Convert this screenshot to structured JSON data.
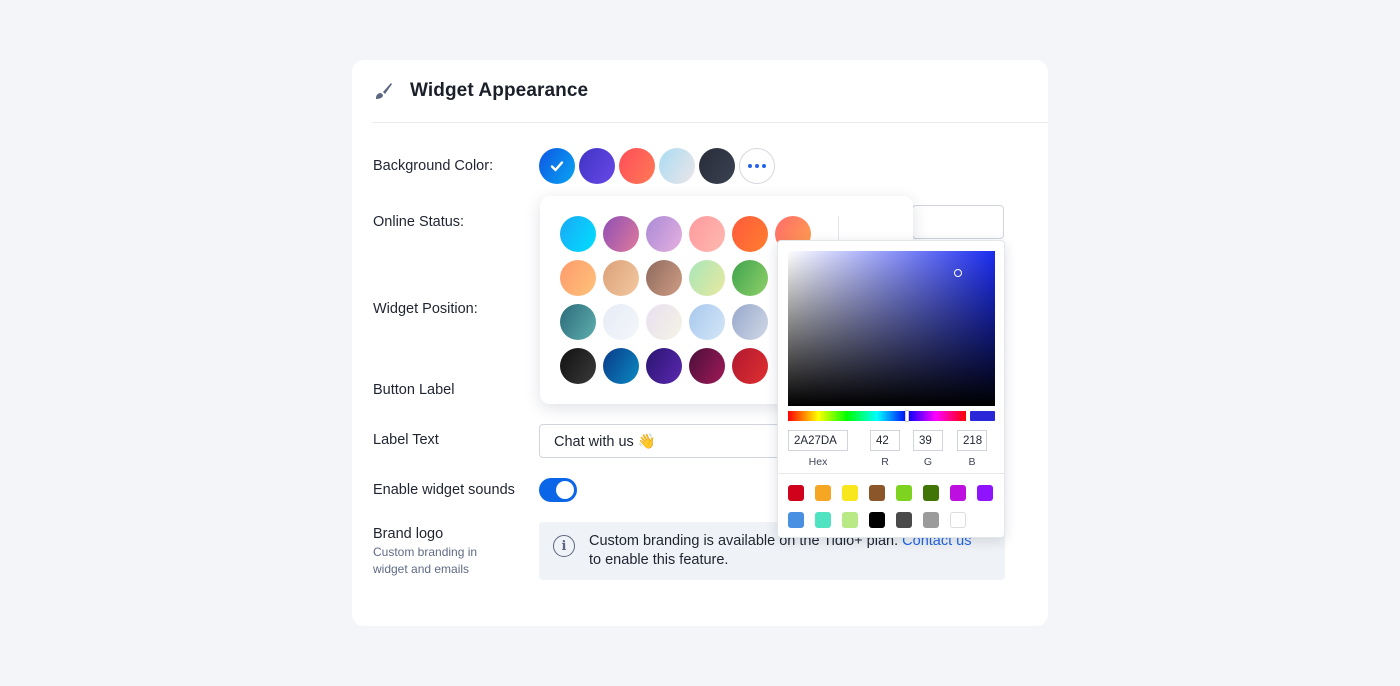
{
  "header": {
    "title": "Widget Appearance",
    "icon": "paintbrush-icon"
  },
  "labels": {
    "background_color": "Background Color:",
    "online_status": "Online Status:",
    "widget_position": "Widget Position:",
    "button_label": "Button Label",
    "label_text": "Label Text",
    "enable_sounds": "Enable widget sounds",
    "brand_logo": "Brand logo",
    "brand_logo_sub": "Custom branding in widget and emails"
  },
  "background_swatches": [
    {
      "name": "blue",
      "gradient": [
        "#0c56e3",
        "#0aa6f2"
      ],
      "selected": true
    },
    {
      "name": "purple",
      "gradient": [
        "#3e34c4",
        "#6a48e6"
      ],
      "selected": false
    },
    {
      "name": "coral",
      "gradient": [
        "#ff4d5a",
        "#ff7a55"
      ],
      "selected": false
    },
    {
      "name": "light-blue",
      "gradient": [
        "#a9dcf3",
        "#ece5e8"
      ],
      "selected": false
    },
    {
      "name": "dark",
      "gradient": [
        "#272c38",
        "#3b4252"
      ],
      "selected": false
    }
  ],
  "more_colors_icon": "more-dots-icon",
  "label_text_value": "Chat with us 👋",
  "sounds_enabled": true,
  "info": {
    "text": "Custom branding is available on the Tidio+ plan.",
    "link": "Contact us",
    "text_after": "to enable this feature."
  },
  "gradient_palette": [
    [
      "#1aa8f5",
      "#00e0ff"
    ],
    [
      "#8e4fb5",
      "#e07a9c"
    ],
    [
      "#a98ad6",
      "#e6b0e0"
    ],
    [
      "#ff9a9e",
      "#fdb9b0"
    ],
    [
      "#ff5a3c",
      "#ff7e2e"
    ],
    [
      "#ff6b6b",
      "#ffa14d"
    ],
    [
      "#ff9a6c",
      "#fdc37a"
    ],
    [
      "#dba079",
      "#f3c9a0"
    ],
    [
      "#8e6a5e",
      "#cf9d84"
    ],
    [
      "#a8e6b8",
      "#e8e8a0"
    ],
    [
      "#3fa34d",
      "#8fd06a"
    ],
    null,
    [
      "#2c6a7a",
      "#5fb0ae"
    ],
    [
      "#e6ecf6",
      "#f4f6fa"
    ],
    [
      "#e8e0f0",
      "#f5f3e5"
    ],
    [
      "#a8c8ee",
      "#d4e6f6"
    ],
    [
      "#98a8cc",
      "#d0d8e6"
    ],
    null,
    [
      "#111111",
      "#3a3a3a"
    ],
    [
      "#0a3a8a",
      "#0a8ac0"
    ],
    [
      "#2a1570",
      "#5a28b0"
    ],
    [
      "#4a0f3a",
      "#a01a58"
    ],
    [
      "#b01830",
      "#e03030"
    ],
    null
  ],
  "picker": {
    "hex": "2A27DA",
    "r": "42",
    "g": "39",
    "b": "218",
    "hex_label": "Hex",
    "r_label": "R",
    "g_label": "G",
    "b_label": "B",
    "current_color": "#2a27da",
    "presets": [
      "#d0021b",
      "#f5a623",
      "#f8e71c",
      "#8b572a",
      "#7ed321",
      "#417505",
      "#bd10e0",
      "#9013fe",
      "#4a90e2",
      "#50e3c2",
      "#b8e986",
      "#000000",
      "#4a4a4a",
      "#9b9b9b",
      "#ffffff"
    ]
  }
}
